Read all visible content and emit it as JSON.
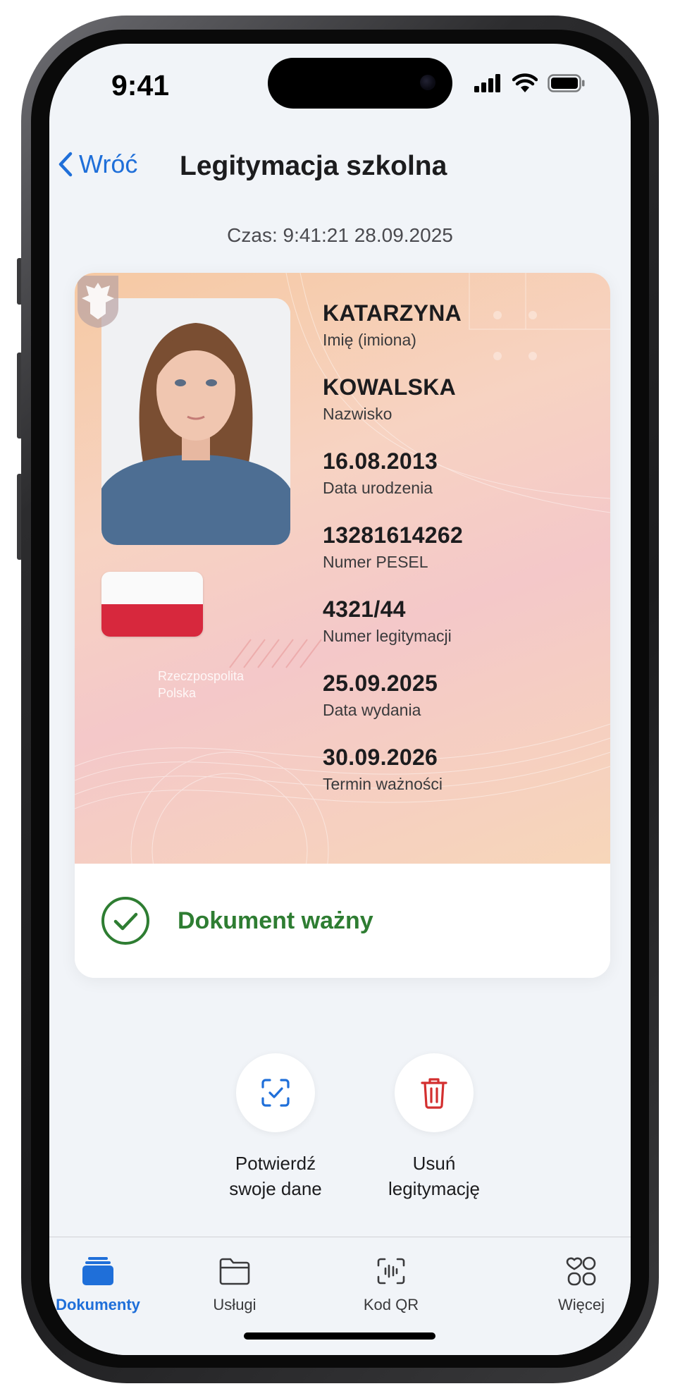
{
  "status_bar": {
    "time": "9:41"
  },
  "nav": {
    "back_label": "Wróć",
    "title": "Legitymacja szkolna"
  },
  "timestamp": "Czas: 9:41:21 28.09.2025",
  "card": {
    "issuer_line1": "Rzeczpospolita",
    "issuer_line2": "Polska",
    "fields": [
      {
        "value": "KATARZYNA",
        "label": "Imię (imiona)"
      },
      {
        "value": "KOWALSKA",
        "label": "Nazwisko"
      },
      {
        "value": "16.08.2013",
        "label": "Data urodzenia"
      },
      {
        "value": "13281614262",
        "label": "Numer PESEL"
      },
      {
        "value": "4321/44",
        "label": "Numer legitymacji"
      },
      {
        "value": "25.09.2025",
        "label": "Data wydania"
      },
      {
        "value": "30.09.2026",
        "label": "Termin ważności"
      }
    ],
    "status_text": "Dokument ważny"
  },
  "actions": [
    {
      "label": "Potwierdź\nswoje dane",
      "icon": "scan-check-icon"
    },
    {
      "label": "Usuń\nlegitymację",
      "icon": "trash-icon"
    }
  ],
  "tabs": [
    {
      "label": "Dokumenty",
      "icon": "documents-icon",
      "active": true
    },
    {
      "label": "Usługi",
      "icon": "folder-icon",
      "active": false
    },
    {
      "label": "Kod QR",
      "icon": "qr-scan-icon",
      "active": false
    },
    {
      "label": "Więcej",
      "icon": "more-grid-icon",
      "active": false
    }
  ],
  "colors": {
    "accent": "#1f6fd9",
    "success": "#2e7d32",
    "danger": "#d32f2f",
    "flag_red": "#d7283d"
  }
}
